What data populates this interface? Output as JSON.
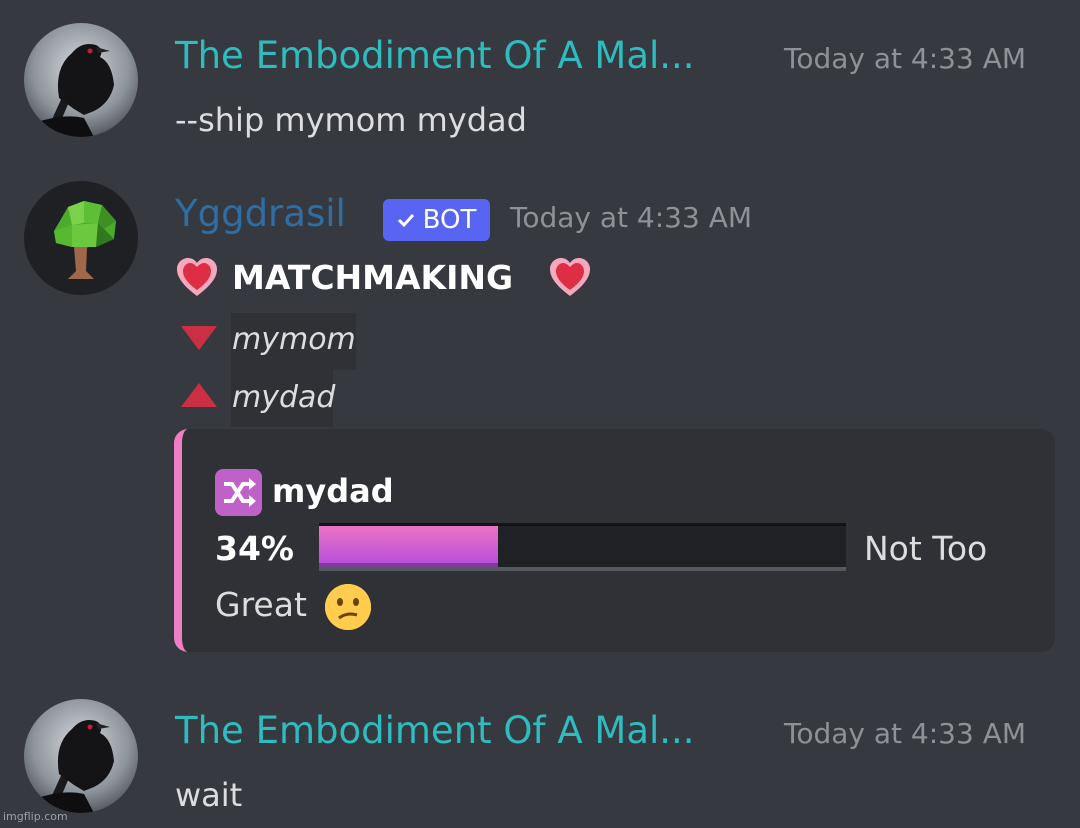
{
  "messages": [
    {
      "author": "The Embodiment Of A Mal...",
      "author_color": "#2fbcbf",
      "timestamp": "Today at 4:33 AM",
      "text": "--ship mymom mydad",
      "avatar": "raven-avatar"
    },
    {
      "author": "Yggdrasil",
      "author_color": "#2e6ea3",
      "badge": "BOT",
      "timestamp": "Today at 4:33 AM",
      "heading": "MATCHMAKING",
      "name_down": "mymom",
      "name_up": "mydad",
      "avatar": "tree-avatar",
      "embed": {
        "title": "mydad",
        "percent": "34%",
        "progress": 0.34,
        "description_line1": "Not Too",
        "description_line2": "Great",
        "accent_color": "#ef7ec6"
      }
    },
    {
      "author": "The Embodiment Of A Mal...",
      "author_color": "#2fbcbf",
      "timestamp": "Today at 4:33 AM",
      "text": "wait",
      "avatar": "raven-avatar"
    }
  ],
  "watermark": "imgflip.com"
}
